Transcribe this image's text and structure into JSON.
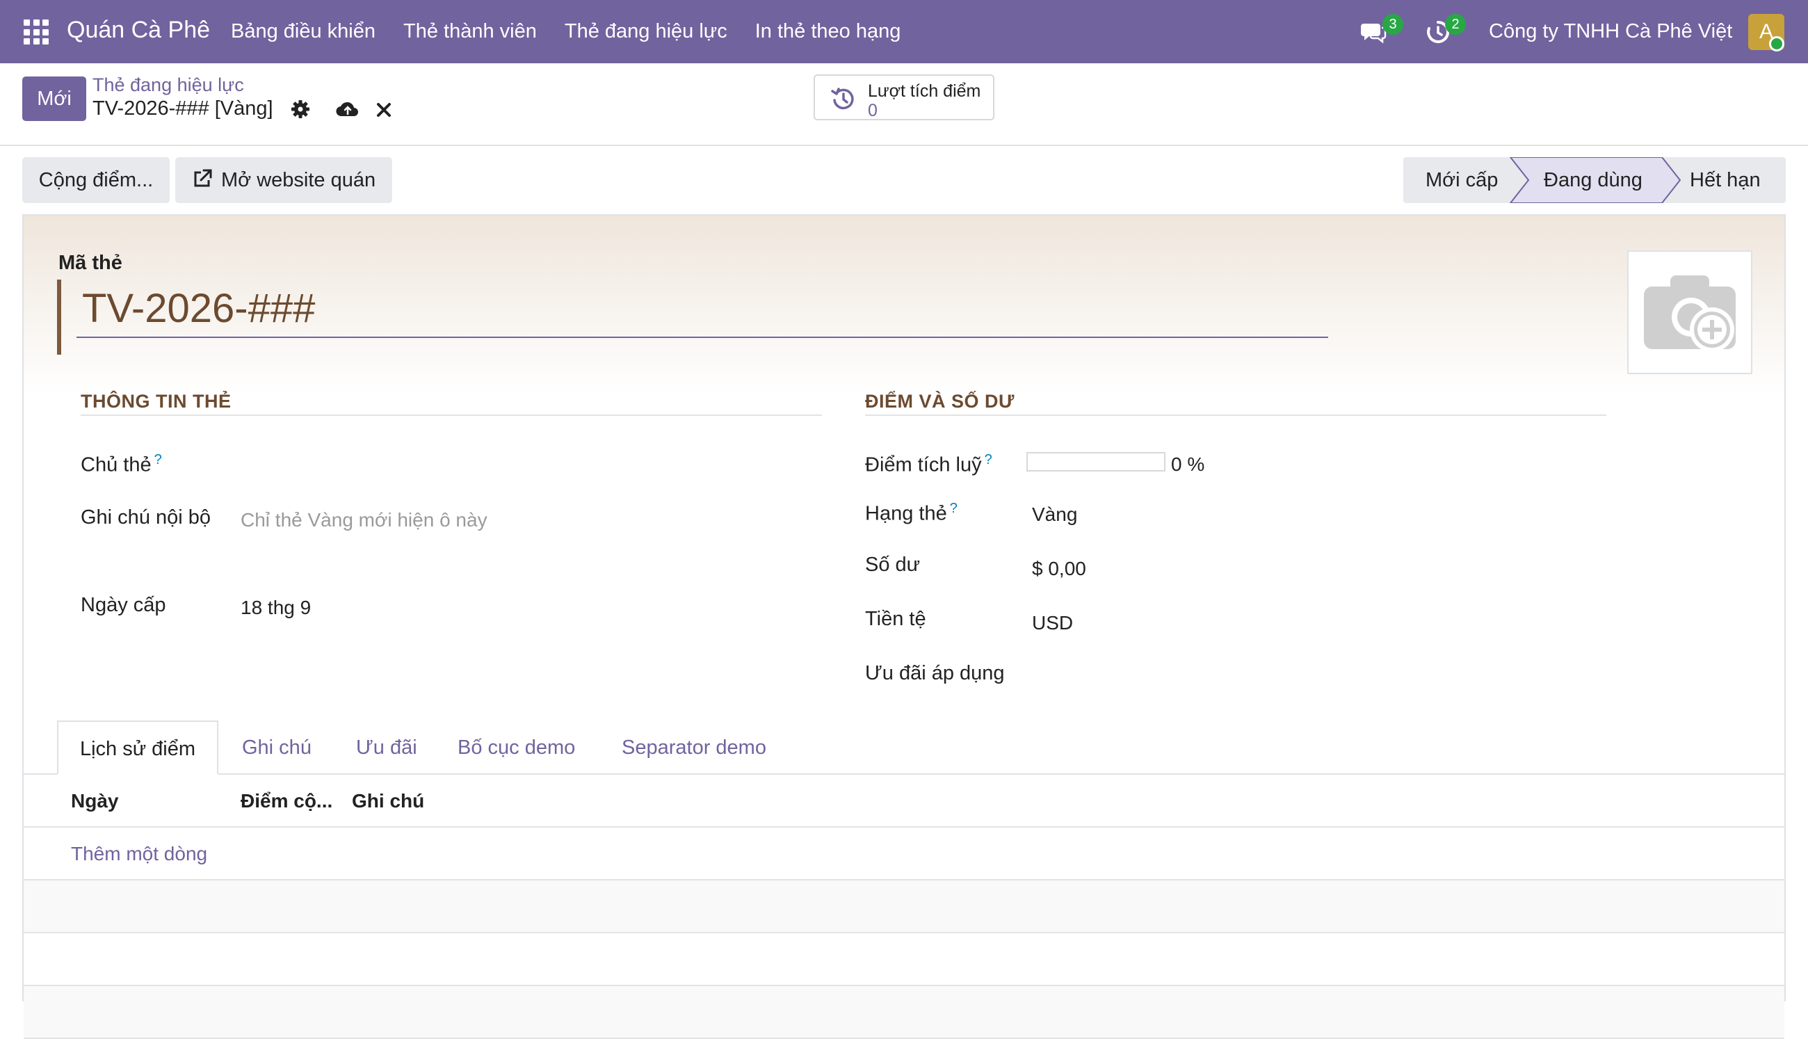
{
  "navbar": {
    "brand": "Quán Cà Phê",
    "menu": [
      "Bảng điều khiển",
      "Thẻ thành viên",
      "Thẻ đang hiệu lực",
      "In thẻ theo hạng"
    ],
    "messages_count": "3",
    "activities_count": "2",
    "company": "Công ty TNHH Cà Phê Việt",
    "avatar_letter": "A",
    "color": "#71639e"
  },
  "control": {
    "new_button": "Mới",
    "breadcrumb_parent": "Thẻ đang hiệu lực",
    "breadcrumb_current": "TV-2026-### [Vàng]",
    "stat_button": {
      "label": "Lượt tích điểm",
      "value": "0"
    }
  },
  "actions": {
    "add_points": "Cộng điểm...",
    "open_website": "Mở website quán"
  },
  "statusbar": {
    "stages": [
      "Mới cấp",
      "Đang dùng",
      "Hết hạn"
    ],
    "active": "Đang dùng"
  },
  "form": {
    "code_label": "Mã thẻ",
    "code_value": "TV-2026-###",
    "left_section": {
      "title": "THÔNG TIN THẺ",
      "holder_label": "Chủ thẻ",
      "holder_help": "?",
      "note_label": "Ghi chú nội bộ",
      "note_placeholder": "Chỉ thẻ Vàng mới hiện ô này",
      "issue_label": "Ngày cấp",
      "issue_value": "18 thg 9"
    },
    "right_section": {
      "title": "ĐIỂM VÀ SỐ DƯ",
      "points_label": "Điểm tích luỹ",
      "points_help": "?",
      "points_value": "0 %",
      "points_progress": 0,
      "tier_label": "Hạng thẻ",
      "tier_help": "?",
      "tier_value": "Vàng",
      "balance_label": "Số dư",
      "balance_value": "$ 0,00",
      "currency_label": "Tiền tệ",
      "currency_value": "USD",
      "offer_label": "Ưu đãi áp dụng"
    }
  },
  "notebook": {
    "tabs": [
      "Lịch sử điểm",
      "Ghi chú",
      "Ưu đãi",
      "Bố cục demo",
      "Separator demo"
    ],
    "active_tab": "Lịch sử điểm",
    "columns": [
      "Ngày",
      "Điểm cộ...",
      "Ghi chú"
    ],
    "add_line": "Thêm một dòng"
  }
}
